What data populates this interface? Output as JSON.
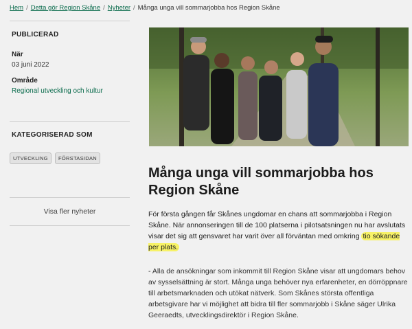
{
  "breadcrumb": {
    "items": [
      "Hem",
      "Detta gör Region Skåne",
      "Nyheter"
    ],
    "current": "Många unga vill sommarjobba hos Region Skåne"
  },
  "sidebar": {
    "published_heading": "PUBLICERAD",
    "when_label": "När",
    "when_value": "03 juni 2022",
    "area_label": "Område",
    "area_value": "Regional utveckling och kultur",
    "categorized_heading": "KATEGORISERAD SOM",
    "tags": [
      "UTVECKLING",
      "FÖRSTASIDAN"
    ],
    "more_news": "Visa fler nyheter"
  },
  "article": {
    "title": "Många unga vill sommarjobba hos Region Skåne",
    "lead_start": "För första gången får Skånes ungdomar en chans att sommarjobba i Region Skåne. När annonseringen till de 100 platserna i pilotsatsningen nu har avslutats visar det sig att gensvaret har varit över all förväntan med omkring",
    "lead_highlight": "tio sökande per plats.",
    "body": "- Alla de ansökningar som inkommit till Region Skåne visar att ungdomars behov av sysselsättning är stort. Många unga behöver nya erfarenheter, en dörröppnare till arbetsmarknaden och utökat nätverk. Som Skånes största offentliga arbetsgivare har vi möjlighet att bidra till fler sommarjobb i Skåne säger Ulrika Geeraedts, utvecklingsdirektör i Region Skåne."
  },
  "colors": {
    "link": "#0a6b4c",
    "highlight": "#f7f267",
    "background": "#f1f1f1"
  }
}
